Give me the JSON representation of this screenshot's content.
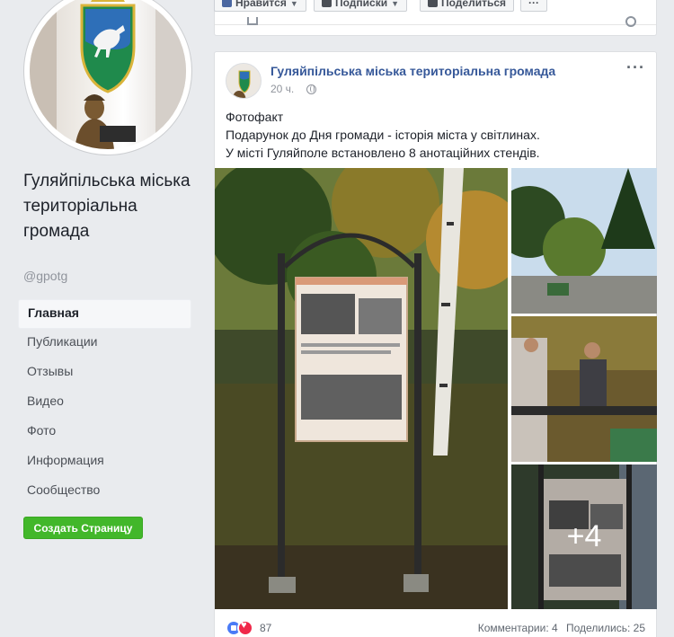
{
  "page": {
    "name": "Гуляйпільська міська територіальна громада",
    "handle": "@gpotg"
  },
  "sidebar": {
    "items": [
      {
        "label": "Главная",
        "active": true
      },
      {
        "label": "Публикации"
      },
      {
        "label": "Отзывы"
      },
      {
        "label": "Видео"
      },
      {
        "label": "Фото"
      },
      {
        "label": "Информация"
      },
      {
        "label": "Сообщество"
      }
    ],
    "create_button": "Создать Страницу"
  },
  "topbar": {
    "like": "Нравится",
    "follow": "Подписки",
    "share": "Поделиться",
    "more": "···"
  },
  "post": {
    "author": "Гуляйпільська міська територіальна громада",
    "time": "20 ч.",
    "more": "···",
    "text_lines": [
      "Фотофакт",
      "Подарунок до Дня громади - історія міста у світлинах.",
      "У місті Гуляйполе встановлено 8 анотаційних стендів."
    ],
    "extra_photos": "+4",
    "reactions_count": "87",
    "comments": "Комментарии: 4",
    "shares": "Поделились: 25"
  },
  "colors": {
    "link": "#365899",
    "green_button": "#42b72a",
    "background": "#e9ebee"
  }
}
